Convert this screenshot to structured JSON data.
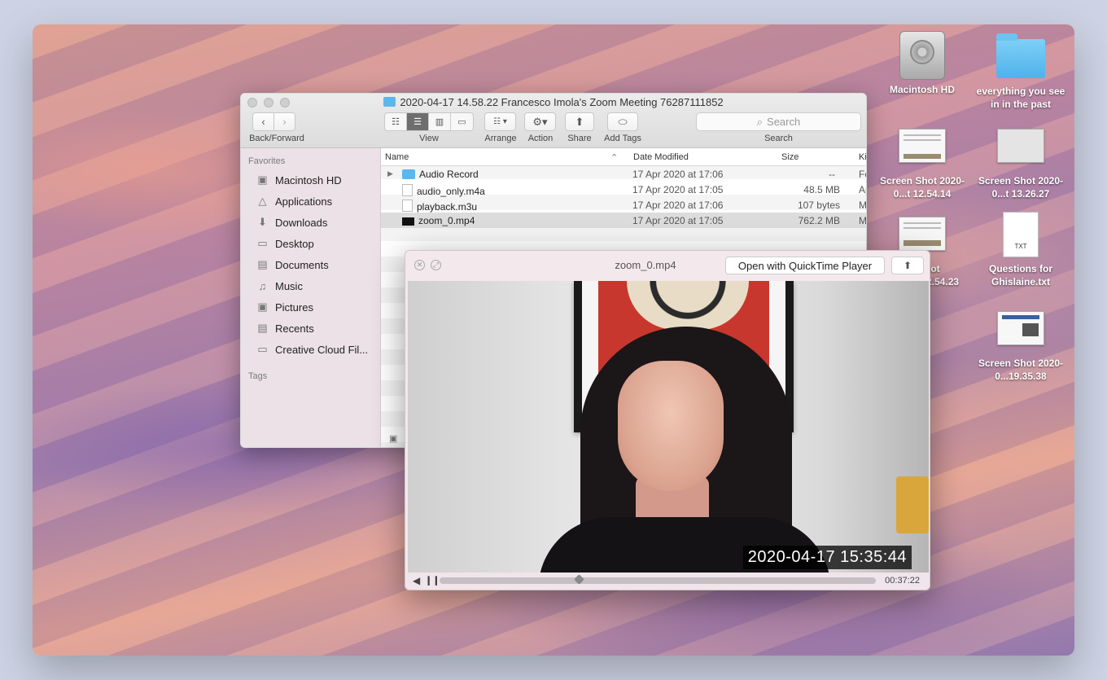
{
  "desktop": {
    "icons": [
      {
        "label": "Macintosh HD",
        "icon": "hard-drive-icon"
      },
      {
        "label": "everything you see in in the past",
        "icon": "folder-icon"
      },
      {
        "label": "Screen Shot 2020-0...t 12.54.14",
        "icon": "screenshot-thumbnail"
      },
      {
        "label": "Screen Shot 2020-0...t 13.26.27",
        "icon": "screenshot-thumbnail"
      },
      {
        "label": "Shot ...2.54.23",
        "icon": "screenshot-thumbnail"
      },
      {
        "label": "Questions for Ghislaine.txt",
        "icon": "text-file-icon",
        "badge": "TXT"
      },
      {
        "label": "Screen Shot 2020-0...19.35.38",
        "icon": "screenshot-thumbnail"
      }
    ]
  },
  "finder": {
    "title": "2020-04-17 14.58.22 Francesco Imola's Zoom Meeting 76287111852",
    "toolbar": {
      "back_forward": "Back/Forward",
      "view": "View",
      "arrange": "Arrange",
      "action": "Action",
      "share": "Share",
      "add_tags": "Add Tags",
      "search_label": "Search",
      "search_placeholder": "Search"
    },
    "sidebar": {
      "favorites_heading": "Favorites",
      "tags_heading": "Tags",
      "items": [
        {
          "label": "Macintosh HD",
          "icon": "hard-drive-icon"
        },
        {
          "label": "Applications",
          "icon": "applications-icon"
        },
        {
          "label": "Downloads",
          "icon": "downloads-icon"
        },
        {
          "label": "Desktop",
          "icon": "desktop-icon"
        },
        {
          "label": "Documents",
          "icon": "documents-icon"
        },
        {
          "label": "Music",
          "icon": "music-icon"
        },
        {
          "label": "Pictures",
          "icon": "pictures-icon"
        },
        {
          "label": "Recents",
          "icon": "recents-icon"
        },
        {
          "label": "Creative Cloud Fil...",
          "icon": "folder-icon"
        }
      ]
    },
    "columns": {
      "name": "Name",
      "date": "Date Modified",
      "size": "Size",
      "kind": "Ki"
    },
    "rows": [
      {
        "name": "Audio Record",
        "date": "17 Apr 2020 at 17:06",
        "size": "--",
        "kind": "Fo",
        "type": "folder"
      },
      {
        "name": "audio_only.m4a",
        "date": "17 Apr 2020 at 17:05",
        "size": "48.5 MB",
        "kind": "Ap",
        "type": "audio"
      },
      {
        "name": "playback.m3u",
        "date": "17 Apr 2020 at 17:06",
        "size": "107 bytes",
        "kind": "M",
        "type": "playlist"
      },
      {
        "name": "zoom_0.mp4",
        "date": "17 Apr 2020 at 17:05",
        "size": "762.2 MB",
        "kind": "M",
        "type": "video",
        "selected": true
      }
    ]
  },
  "quicklook": {
    "title": "zoom_0.mp4",
    "open_button": "Open with QuickTime Player",
    "timestamp_overlay": "2020-04-17  15:35:44",
    "duration": "00:37:22",
    "progress": 0.32
  }
}
